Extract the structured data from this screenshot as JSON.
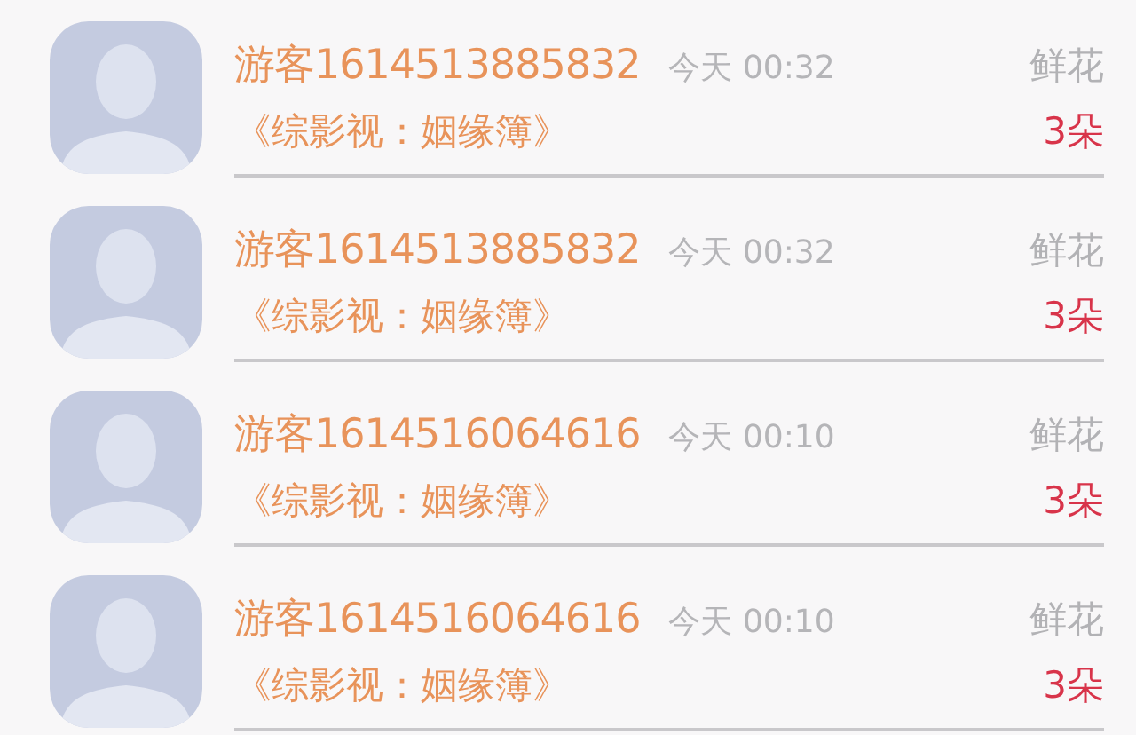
{
  "gifts": [
    {
      "user": "游客1614513885832",
      "time": "今天 00:32",
      "work": "《综影视：姻缘簿》",
      "gift": "鲜花",
      "amount": "3朵"
    },
    {
      "user": "游客1614513885832",
      "time": "今天 00:32",
      "work": "《综影视：姻缘簿》",
      "gift": "鲜花",
      "amount": "3朵"
    },
    {
      "user": "游客1614516064616",
      "time": "今天 00:10",
      "work": "《综影视：姻缘簿》",
      "gift": "鲜花",
      "amount": "3朵"
    },
    {
      "user": "游客1614516064616",
      "time": "今天 00:10",
      "work": "《综影视：姻缘簿》",
      "gift": "鲜花",
      "amount": "3朵"
    }
  ]
}
